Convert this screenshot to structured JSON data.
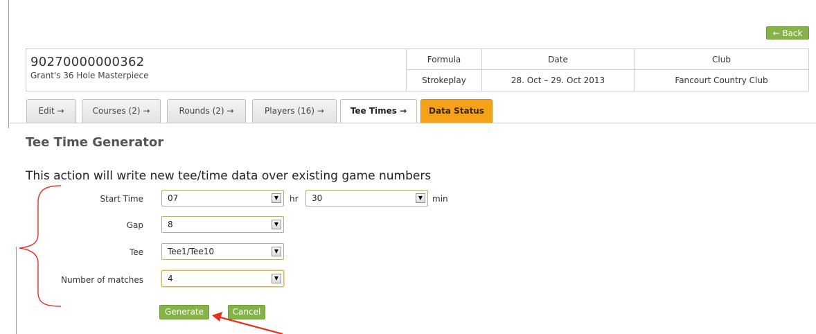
{
  "header": {
    "back_label": "← Back",
    "game_id": "90270000000362",
    "game_name": "Grant's 36 Hole Masterpiece",
    "formula_header": "Formula",
    "formula_value": "Strokeplay",
    "date_header": "Date",
    "date_value": "28. Oct – 29. Oct 2013",
    "club_header": "Club",
    "club_value": "Fancourt Country Club"
  },
  "tabs": [
    {
      "label": "Edit →"
    },
    {
      "label": "Courses (2) →"
    },
    {
      "label": "Rounds (2) →"
    },
    {
      "label": "Players (16) →"
    },
    {
      "label": "Tee Times →"
    },
    {
      "label": "Data Status"
    }
  ],
  "main": {
    "title": "Tee Time Generator",
    "warning": "This action will write new tee/time data over existing game numbers",
    "start_time_label": "Start Time",
    "start_hour": "07",
    "hr_unit": "hr",
    "start_min": "30",
    "min_unit": "min",
    "gap_label": "Gap",
    "gap_value": "8",
    "tee_label": "Tee",
    "tee_value": "Tee1/Tee10",
    "matches_label": "Number of matches",
    "matches_value": "4",
    "generate_label": "Generate",
    "cancel_label": "Cancel"
  },
  "annotation_color": "#e8301c",
  "accent_green": "#86b24a",
  "data_status_color": "#f5a11a"
}
